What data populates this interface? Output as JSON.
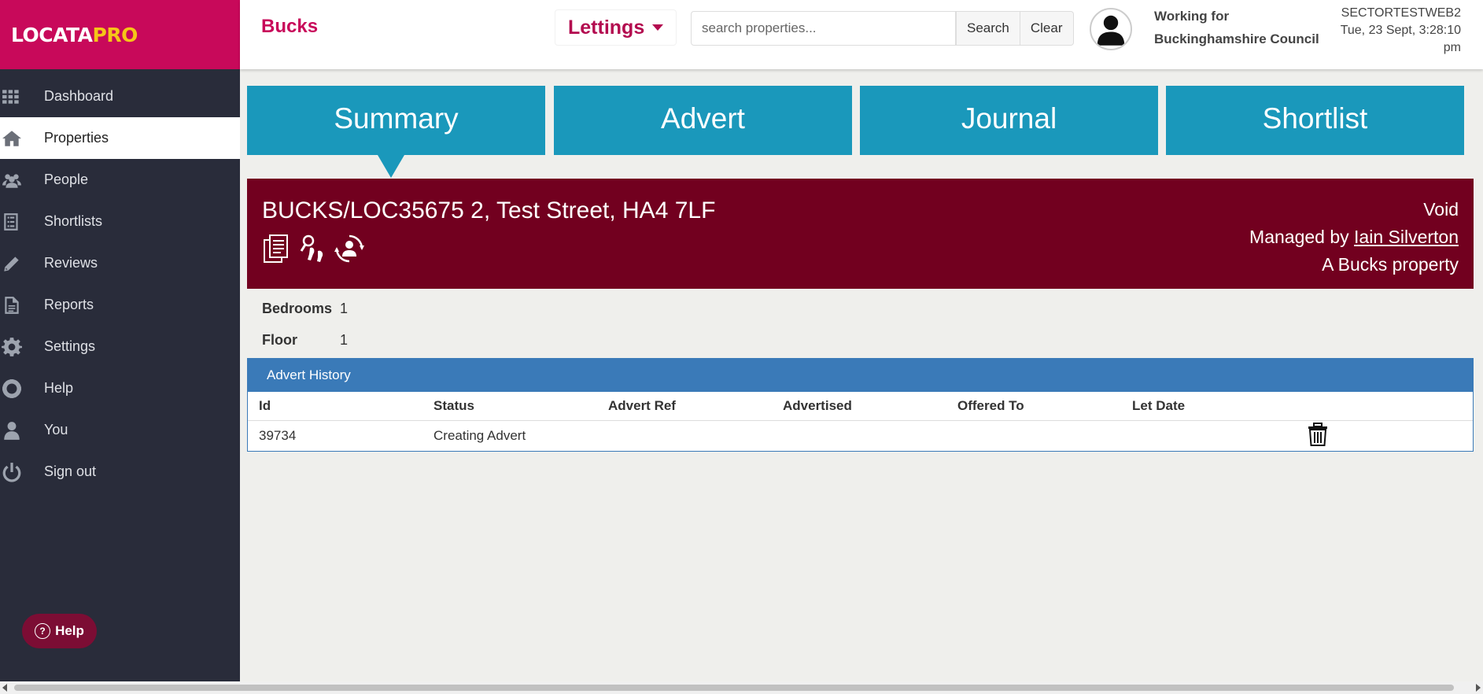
{
  "brand": {
    "logo_main": "LOCATA",
    "logo_accent": "PRO"
  },
  "sidebar": {
    "items": [
      {
        "label": "Dashboard",
        "icon": "grid-icon"
      },
      {
        "label": "Properties",
        "icon": "house-icon",
        "active": true
      },
      {
        "label": "People",
        "icon": "people-icon"
      },
      {
        "label": "Shortlists",
        "icon": "list-icon"
      },
      {
        "label": "Reviews",
        "icon": "pencil-icon"
      },
      {
        "label": "Reports",
        "icon": "document-icon"
      },
      {
        "label": "Settings",
        "icon": "gear-icon"
      },
      {
        "label": "Help",
        "icon": "lifebuoy-icon"
      },
      {
        "label": "You",
        "icon": "user-icon"
      },
      {
        "label": "Sign out",
        "icon": "power-icon"
      }
    ],
    "help_button": "Help"
  },
  "header": {
    "org": "Bucks",
    "module": "Lettings",
    "search_placeholder": "search properties...",
    "search_button": "Search",
    "clear_button": "Clear",
    "working_for_line1": "Working for",
    "working_for_line2": "Buckinghamshire Council",
    "server": "SECTORTESTWEB2",
    "datetime_line1": "Tue, 23 Sept, 3:28:10",
    "datetime_line2": "pm"
  },
  "tabs": [
    "Summary",
    "Advert",
    "Journal",
    "Shortlist"
  ],
  "property": {
    "address": "BUCKS/LOC35675 2, Test Street, HA4 7LF",
    "status": "Void",
    "managed_by_prefix": "Managed by ",
    "managed_by_name": "Iain Silverton",
    "ownership": "A Bucks property",
    "bedrooms_label": "Bedrooms",
    "bedrooms": "1",
    "floor_label": "Floor",
    "floor": "1"
  },
  "advert_history": {
    "title": "Advert History",
    "columns": [
      "Id",
      "Status",
      "Advert Ref",
      "Advertised",
      "Offered To",
      "Let Date"
    ],
    "rows": [
      {
        "id": "39734",
        "status": "Creating Advert",
        "advert_ref": "",
        "advertised": "",
        "offered_to": "",
        "let_date": ""
      }
    ]
  },
  "colors": {
    "brand": "#c8095a",
    "sidebar": "#292c3a",
    "tab": "#1a98bb",
    "banner": "#72001f",
    "panel": "#3a7ab8"
  }
}
